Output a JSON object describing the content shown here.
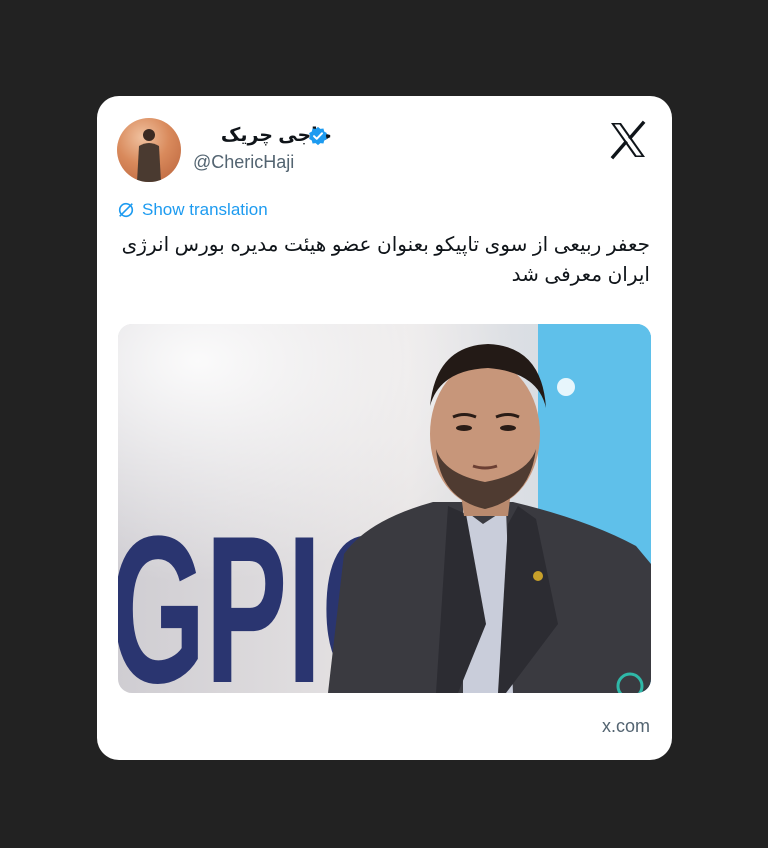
{
  "tweet": {
    "display_name": "حاجی چریک",
    "verified": true,
    "handle": "@ChericHaji",
    "show_translation": "Show translation",
    "text": "جعفر ربیعی از سوی تاپیکو بعنوان عضو هیئت مدیره بورس انرژی ایران معرفی شد",
    "image": {
      "sign_text": "GPIC"
    },
    "source_domain": "x.com"
  },
  "icons": {
    "verified": "verified-badge-icon",
    "logo": "x-logo-icon",
    "translate": "translate-globe-icon"
  },
  "colors": {
    "background": "#222222",
    "card": "#ffffff",
    "accent": "#1d9bf0",
    "text": "#0f1419",
    "secondary": "#536471"
  }
}
